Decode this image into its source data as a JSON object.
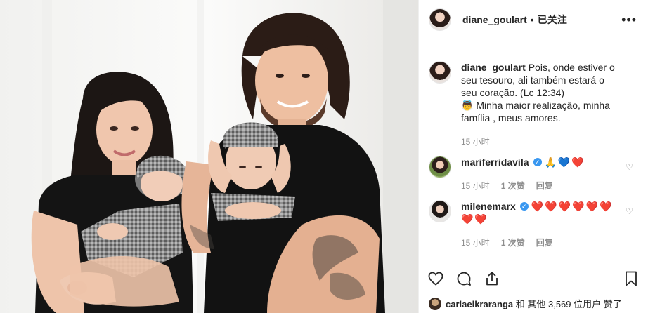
{
  "post": {
    "username": "diane_goulart",
    "dot": "•",
    "follow_status": "已关注",
    "more_icon": "more-horizontal-icon"
  },
  "caption": {
    "username": "diane_goulart",
    "text_line1": "Pois, onde estiver o seu tesouro, ali também estará o seu coração. (Lc 12:34)",
    "text_line2": "Minha maior realização, minha família , meus amores.",
    "emoji": "👼",
    "time": "15 小时"
  },
  "comments": [
    {
      "username": "mariferridavila",
      "verified": true,
      "emoji_text": "🙏💙❤️",
      "time": "15 小时",
      "likes": "1 次赞",
      "reply": "回复"
    },
    {
      "username": "milenemarx",
      "verified": true,
      "emoji_text": "❤️❤️❤️❤️❤️❤️❤️❤️",
      "time": "15 小时",
      "likes": "1 次赞",
      "reply": "回复"
    }
  ],
  "likes_line": {
    "text_bold": "carlaelkraranga",
    "text_rest": "和 其他 3,569 位用户 赞了"
  },
  "icons": {
    "like": "heart-icon",
    "comment": "comment-icon",
    "share": "share-icon",
    "save": "bookmark-icon"
  }
}
